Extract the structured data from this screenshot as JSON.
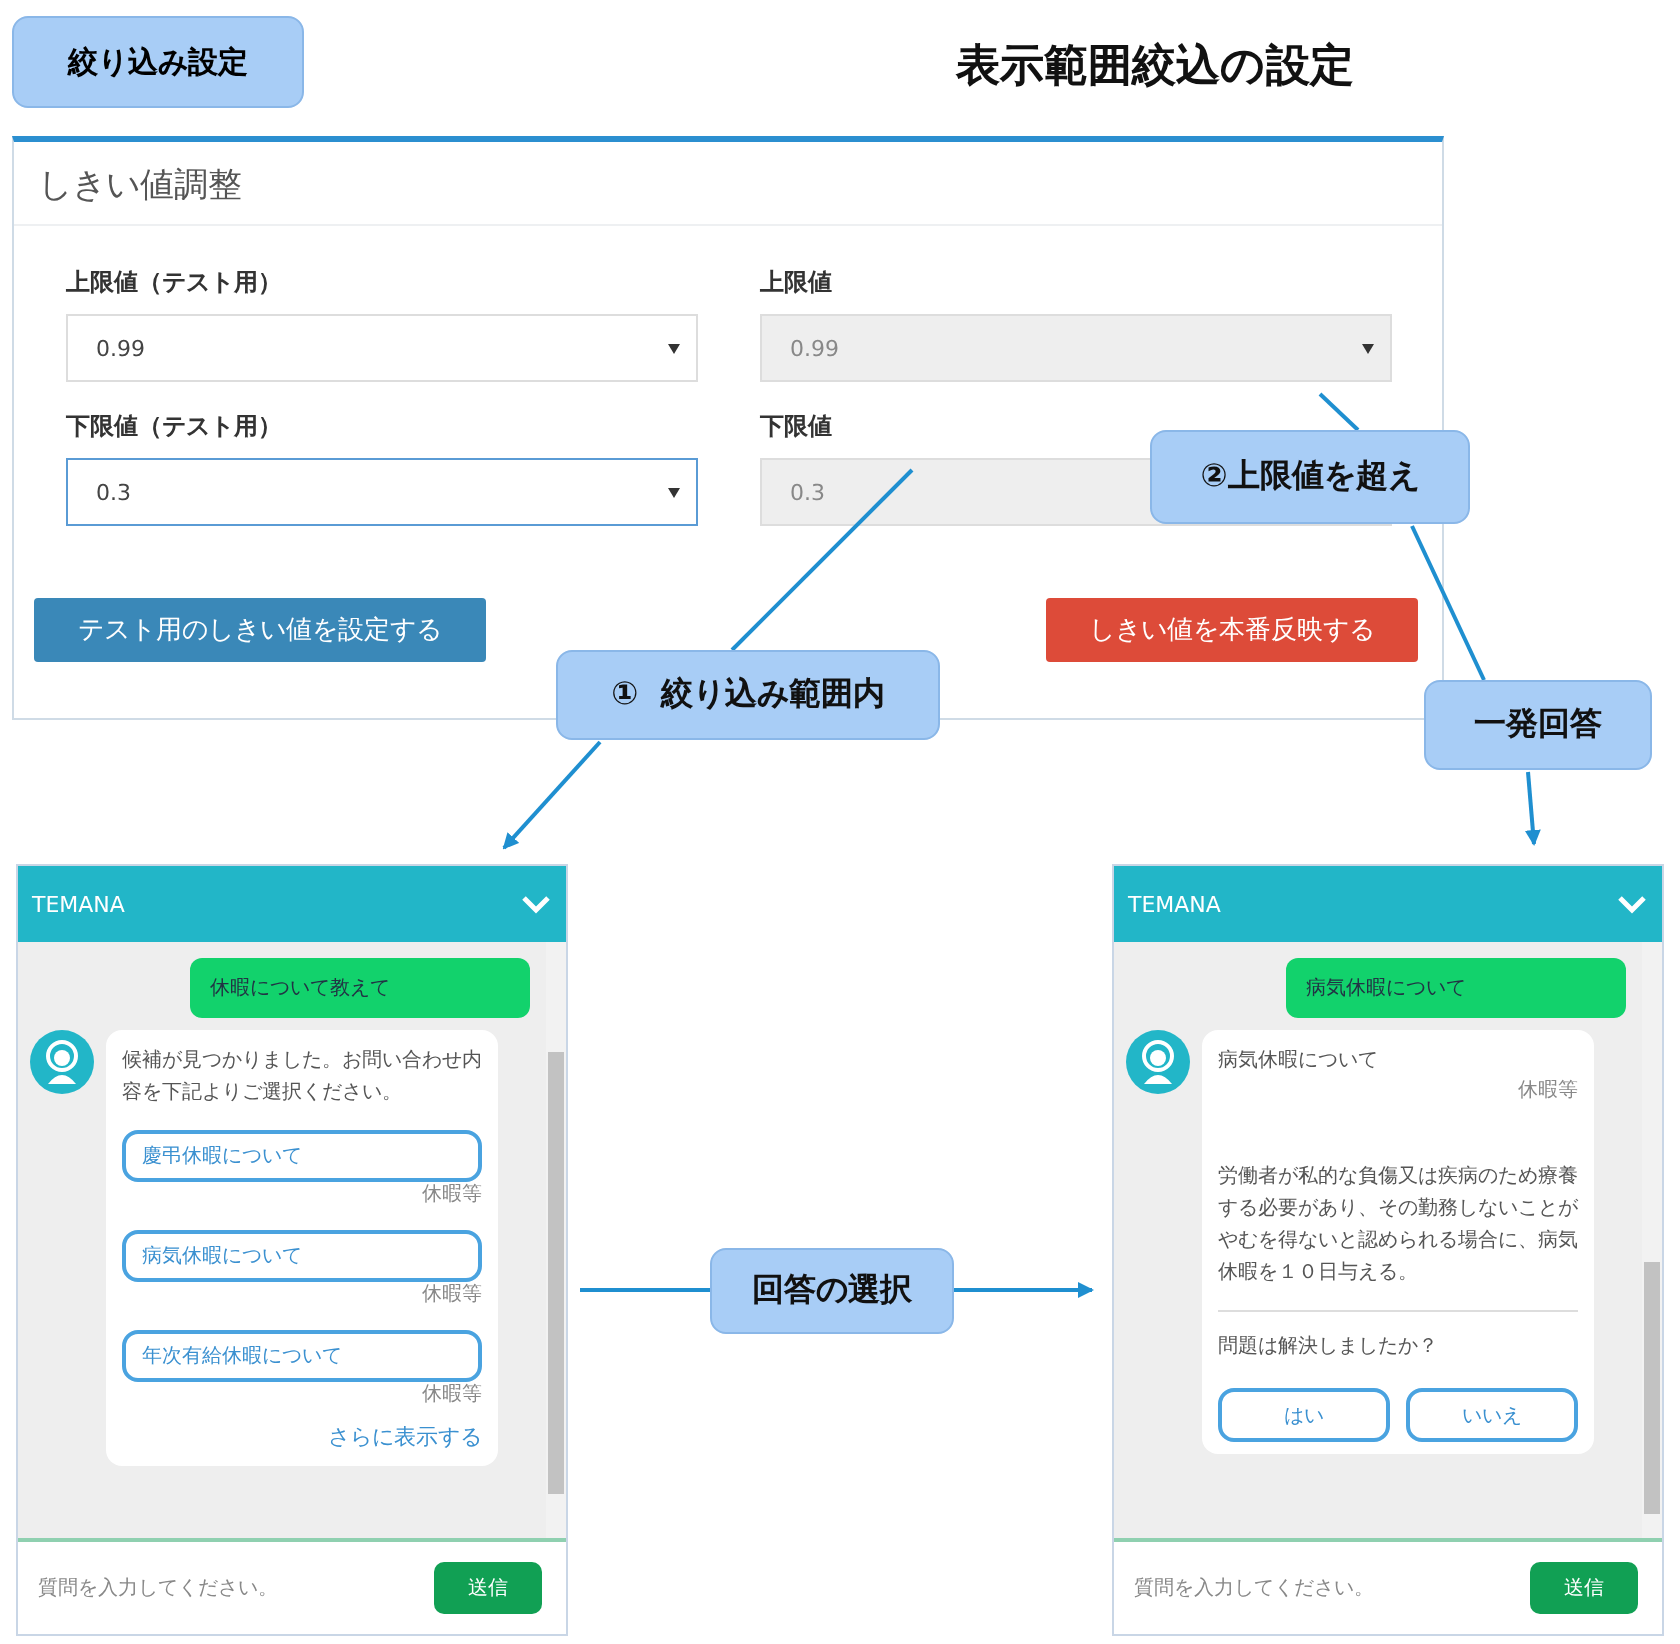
{
  "page_label": "絞り込み設定",
  "title": "表示範囲絞込の設定",
  "settings": {
    "title": "しきい値調整",
    "fields": [
      {
        "label": "上限値（テスト用）",
        "value": "0.99",
        "disabled": false,
        "focused": false
      },
      {
        "label": "上限値",
        "value": "0.99",
        "disabled": true,
        "focused": false
      },
      {
        "label": "下限値（テスト用）",
        "value": "0.3",
        "disabled": false,
        "focused": true
      },
      {
        "label": "下限値",
        "value": "0.3",
        "disabled": true,
        "focused": false
      }
    ],
    "buttons": [
      {
        "label": "テスト用のしきい値を設定する",
        "kind": "primary"
      },
      {
        "label": "しきい値を本番反映する",
        "kind": "danger"
      }
    ]
  },
  "callouts": [
    {
      "text": "②上限値を超え"
    },
    {
      "text": "①  絞り込み範囲内"
    },
    {
      "text": "一発回答"
    },
    {
      "text": "回答の選択"
    }
  ],
  "chats": [
    {
      "title": "TEMANA",
      "user_message": "休暇について教えて",
      "bot": {
        "kind": "choices",
        "text": "候補が見つかりました。お問い合わせ内容を下記よりご選択ください。",
        "options": [
          {
            "label": "慶弔休暇について",
            "category": "休暇等"
          },
          {
            "label": "病気休暇について",
            "category": "休暇等"
          },
          {
            "label": "年次有給休暇について",
            "category": "休暇等"
          }
        ],
        "more": "さらに表示する"
      },
      "placeholder": "質問を入力してください。",
      "send": "送信"
    },
    {
      "title": "TEMANA",
      "user_message": "病気休暇について",
      "bot": {
        "kind": "answer",
        "title": "病気休暇について",
        "category": "休暇等",
        "body": "労働者が私的な負傷又は疾病のため療養する必要があり、その勤務しないことがやむを得ないと認められる場合に、病気休暇を１０日与える。",
        "question": "問題は解決しましたか？",
        "buttons": [
          "はい",
          "いいえ"
        ]
      },
      "placeholder": "質問を入力してください。",
      "send": "送信"
    }
  ]
}
